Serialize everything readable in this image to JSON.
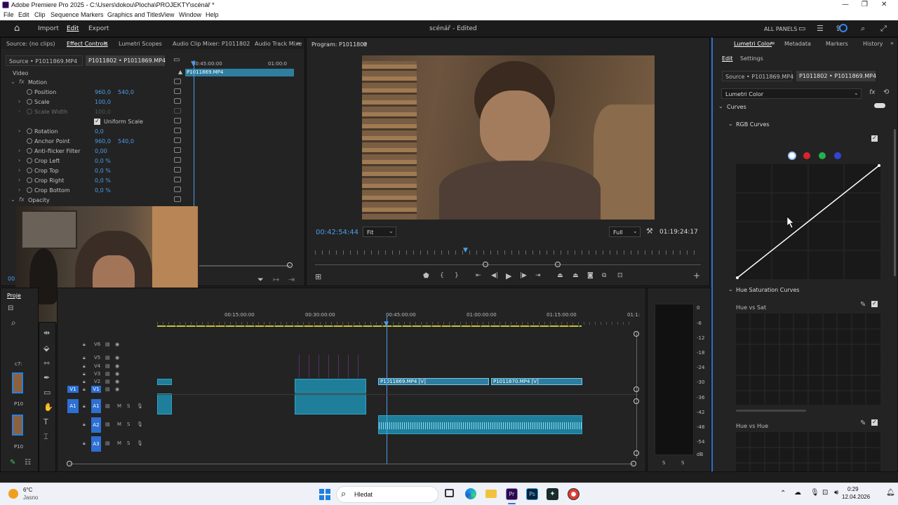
{
  "window": {
    "title": "Adobe Premiere Pro 2025 - C:\\Users\\dokou\\Plocha\\PROJEKTY\\scénář *"
  },
  "menu": [
    "File",
    "Edit",
    "Clip",
    "Sequence",
    "Markers",
    "Graphics and Titles",
    "View",
    "Window",
    "Help"
  ],
  "header": {
    "import": "Import",
    "edit": "Edit",
    "export": "Export",
    "project": "scénář - Edited",
    "all_panels": "ALL PANELS"
  },
  "effect_tabs": {
    "source": "Source: (no clips)",
    "effect_controls": "Effect Controls",
    "lumetri_scopes": "Lumetri Scopes",
    "audio_clip_mixer": "Audio Clip Mixer: P1011802",
    "audio_track_mixer": "Audio Track Mixe"
  },
  "effect_controls": {
    "source_tab": "Source • P1011869.MP4",
    "seq_tab": "P1011802 • P1011869.MP4",
    "ruler_t1": "00:45:00:00",
    "ruler_t2": "01:00:0",
    "clip_bar": "P1011869.MP4",
    "video_label": "Video",
    "motion": "Motion",
    "rows": [
      {
        "label": "Position",
        "v1": "960,0",
        "v2": "540,0"
      },
      {
        "label": "Scale",
        "v1": "100,0",
        "v2": ""
      },
      {
        "label": "Scale Width",
        "v1": "100,0",
        "v2": ""
      },
      {
        "label": "Uniform Scale",
        "v1": "",
        "v2": ""
      },
      {
        "label": "Rotation",
        "v1": "0,0",
        "v2": ""
      },
      {
        "label": "Anchor Point",
        "v1": "960,0",
        "v2": "540,0"
      },
      {
        "label": "Anti-flicker Filter",
        "v1": "0,00",
        "v2": ""
      },
      {
        "label": "Crop Left",
        "v1": "0,0 %",
        "v2": ""
      },
      {
        "label": "Crop Top",
        "v1": "0,0 %",
        "v2": ""
      },
      {
        "label": "Crop Right",
        "v1": "0,0 %",
        "v2": ""
      },
      {
        "label": "Crop Bottom",
        "v1": "0,0 %",
        "v2": ""
      }
    ],
    "opacity": "Opacity",
    "timecode": "00:4"
  },
  "program": {
    "title": "Program: P1011802",
    "timecode": "00:42:54:44",
    "fit": "Fit",
    "full": "Full",
    "duration": "01:19:24:17"
  },
  "lumetri": {
    "tabs": {
      "lumetri": "Lumetri Color",
      "metadata": "Metadata",
      "markers": "Markers",
      "history": "History"
    },
    "subtabs": {
      "edit": "Edit",
      "settings": "Settings"
    },
    "source_tab": "Source • P1011869.MP4",
    "seq_tab": "P1011802 • P1011869.MP4",
    "effect_select": "Lumetri Color",
    "curves": "Curves",
    "rgb_curves": "RGB Curves",
    "hue_sat_curves": "Hue Saturation Curves",
    "hue_vs_sat": "Hue vs Sat",
    "hue_vs_hue": "Hue vs Hue",
    "channel_colors": [
      "#ffffff",
      "#d6242e",
      "#22b24c",
      "#2f45d8"
    ]
  },
  "timeline": {
    "project_tab": "Proje",
    "clip_label": "c7:",
    "thumb_labels": [
      "P10",
      "P10"
    ],
    "ruler": [
      "00:15:00:00",
      "00:30:00:00",
      "00:45:00:00",
      "01:00:00:00",
      "01:15:00:00",
      "01:1:"
    ],
    "tracks": [
      "V6",
      "V5",
      "V4",
      "V3",
      "V2",
      "V1",
      "A1",
      "A2",
      "A3"
    ],
    "src_v": "V1",
    "src_a": "A1",
    "clips": {
      "c1": "P1011869.MP4 [V]",
      "c2": "P1011870.MP4 [V]"
    }
  },
  "meter": {
    "scale": [
      "0",
      "-6",
      "-12",
      "-18",
      "-24",
      "-30",
      "-36",
      "-42",
      "-48",
      "-54",
      "dB"
    ],
    "ch": [
      "S",
      "S"
    ]
  },
  "taskbar": {
    "temp": "6°C",
    "weather": "Jasno",
    "search": "Hledat",
    "time": "0:29",
    "date": "12.04.2026"
  }
}
